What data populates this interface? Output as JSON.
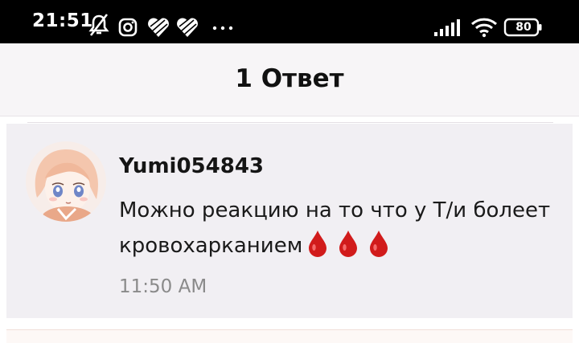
{
  "status_bar": {
    "time": "21:51",
    "battery": "80",
    "icons": [
      "notifications-off-icon",
      "instagram-icon",
      "heart-icon",
      "heart-icon",
      "more-dots-icon",
      "signal-icon",
      "wifi-icon",
      "battery-icon"
    ]
  },
  "header": {
    "title": "1 Ответ"
  },
  "comment": {
    "username": "Yumi054843",
    "text": "Можно реакцию на то что у Т/и болеет кровохарканием",
    "emoji": [
      "drop-of-blood",
      "drop-of-blood",
      "drop-of-blood"
    ],
    "timestamp": "11:50 AM"
  },
  "colors": {
    "status_bar_bg": "#000000",
    "header_bg": "#f7f5f7",
    "card_bg": "#f1eff3",
    "drop_red": "#d11b1b"
  }
}
